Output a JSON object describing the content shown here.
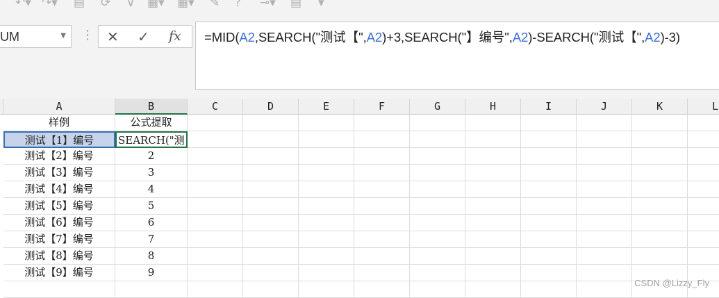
{
  "toolbar": {
    "icons": [
      "undo-icon",
      "redo-icon",
      "format-painter-icon",
      "refresh-icon",
      "filter-icon",
      "table-icon",
      "table-style-icon",
      "edit-icon",
      "help-icon",
      "link-icon",
      "grid-icon",
      "more-icon"
    ]
  },
  "namebox": {
    "value": "UM"
  },
  "formula": {
    "fx_label": "fx",
    "segments": [
      {
        "text": "=MID(",
        "color": "#222222"
      },
      {
        "text": "A2",
        "color": "#3b6fd8"
      },
      {
        "text": ",SEARCH(",
        "color": "#222222"
      },
      {
        "text": "\"测试【\"",
        "color": "#222222"
      },
      {
        "text": ",",
        "color": "#222222"
      },
      {
        "text": "A2",
        "color": "#3b6fd8"
      },
      {
        "text": ")+3,SEARCH(",
        "color": "#222222"
      },
      {
        "text": "\"】编号\"",
        "color": "#222222"
      },
      {
        "text": ",",
        "color": "#222222"
      },
      {
        "text": "A2",
        "color": "#3b6fd8"
      },
      {
        "text": ")-SEARCH(",
        "color": "#222222"
      },
      {
        "text": "\"测试【\"",
        "color": "#222222"
      },
      {
        "text": ",",
        "color": "#222222"
      },
      {
        "text": "A2",
        "color": "#3b6fd8"
      },
      {
        "text": ")-3)",
        "color": "#222222"
      }
    ]
  },
  "columns": [
    "A",
    "B",
    "C",
    "D",
    "E",
    "F",
    "G",
    "H",
    "I",
    "J",
    "K",
    "L"
  ],
  "rows": [
    {
      "a": "样例",
      "b": "公式提取"
    },
    {
      "a": "测试【1】编号",
      "b": "SEARCH(\"测"
    },
    {
      "a": "测试【2】编号",
      "b": "2"
    },
    {
      "a": "测试【3】编号",
      "b": "3"
    },
    {
      "a": "测试【4】编号",
      "b": "4"
    },
    {
      "a": "测试【5】编号",
      "b": "5"
    },
    {
      "a": "测试【6】编号",
      "b": "6"
    },
    {
      "a": "测试【7】编号",
      "b": "7"
    },
    {
      "a": "测试【8】编号",
      "b": "8"
    },
    {
      "a": "测试【9】编号",
      "b": "9"
    },
    {
      "a": "",
      "b": ""
    }
  ],
  "watermark": "CSDN @Lizzy_Fly"
}
